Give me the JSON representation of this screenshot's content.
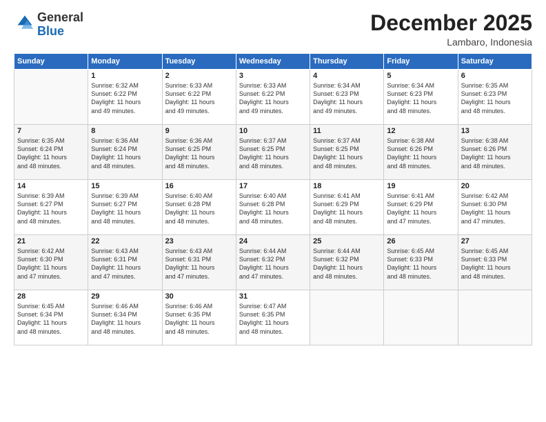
{
  "logo": {
    "general": "General",
    "blue": "Blue"
  },
  "header": {
    "month": "December 2025",
    "location": "Lambaro, Indonesia"
  },
  "days_of_week": [
    "Sunday",
    "Monday",
    "Tuesday",
    "Wednesday",
    "Thursday",
    "Friday",
    "Saturday"
  ],
  "weeks": [
    [
      {
        "day": "",
        "sunrise": "",
        "sunset": "",
        "daylight": ""
      },
      {
        "day": "1",
        "sunrise": "6:32 AM",
        "sunset": "6:22 PM",
        "daylight": "11 hours and 49 minutes."
      },
      {
        "day": "2",
        "sunrise": "6:33 AM",
        "sunset": "6:22 PM",
        "daylight": "11 hours and 49 minutes."
      },
      {
        "day": "3",
        "sunrise": "6:33 AM",
        "sunset": "6:22 PM",
        "daylight": "11 hours and 49 minutes."
      },
      {
        "day": "4",
        "sunrise": "6:34 AM",
        "sunset": "6:23 PM",
        "daylight": "11 hours and 49 minutes."
      },
      {
        "day": "5",
        "sunrise": "6:34 AM",
        "sunset": "6:23 PM",
        "daylight": "11 hours and 48 minutes."
      },
      {
        "day": "6",
        "sunrise": "6:35 AM",
        "sunset": "6:23 PM",
        "daylight": "11 hours and 48 minutes."
      }
    ],
    [
      {
        "day": "7",
        "sunrise": "6:35 AM",
        "sunset": "6:24 PM",
        "daylight": "11 hours and 48 minutes."
      },
      {
        "day": "8",
        "sunrise": "6:36 AM",
        "sunset": "6:24 PM",
        "daylight": "11 hours and 48 minutes."
      },
      {
        "day": "9",
        "sunrise": "6:36 AM",
        "sunset": "6:25 PM",
        "daylight": "11 hours and 48 minutes."
      },
      {
        "day": "10",
        "sunrise": "6:37 AM",
        "sunset": "6:25 PM",
        "daylight": "11 hours and 48 minutes."
      },
      {
        "day": "11",
        "sunrise": "6:37 AM",
        "sunset": "6:25 PM",
        "daylight": "11 hours and 48 minutes."
      },
      {
        "day": "12",
        "sunrise": "6:38 AM",
        "sunset": "6:26 PM",
        "daylight": "11 hours and 48 minutes."
      },
      {
        "day": "13",
        "sunrise": "6:38 AM",
        "sunset": "6:26 PM",
        "daylight": "11 hours and 48 minutes."
      }
    ],
    [
      {
        "day": "14",
        "sunrise": "6:39 AM",
        "sunset": "6:27 PM",
        "daylight": "11 hours and 48 minutes."
      },
      {
        "day": "15",
        "sunrise": "6:39 AM",
        "sunset": "6:27 PM",
        "daylight": "11 hours and 48 minutes."
      },
      {
        "day": "16",
        "sunrise": "6:40 AM",
        "sunset": "6:28 PM",
        "daylight": "11 hours and 48 minutes."
      },
      {
        "day": "17",
        "sunrise": "6:40 AM",
        "sunset": "6:28 PM",
        "daylight": "11 hours and 48 minutes."
      },
      {
        "day": "18",
        "sunrise": "6:41 AM",
        "sunset": "6:29 PM",
        "daylight": "11 hours and 48 minutes."
      },
      {
        "day": "19",
        "sunrise": "6:41 AM",
        "sunset": "6:29 PM",
        "daylight": "11 hours and 47 minutes."
      },
      {
        "day": "20",
        "sunrise": "6:42 AM",
        "sunset": "6:30 PM",
        "daylight": "11 hours and 47 minutes."
      }
    ],
    [
      {
        "day": "21",
        "sunrise": "6:42 AM",
        "sunset": "6:30 PM",
        "daylight": "11 hours and 47 minutes."
      },
      {
        "day": "22",
        "sunrise": "6:43 AM",
        "sunset": "6:31 PM",
        "daylight": "11 hours and 47 minutes."
      },
      {
        "day": "23",
        "sunrise": "6:43 AM",
        "sunset": "6:31 PM",
        "daylight": "11 hours and 47 minutes."
      },
      {
        "day": "24",
        "sunrise": "6:44 AM",
        "sunset": "6:32 PM",
        "daylight": "11 hours and 47 minutes."
      },
      {
        "day": "25",
        "sunrise": "6:44 AM",
        "sunset": "6:32 PM",
        "daylight": "11 hours and 48 minutes."
      },
      {
        "day": "26",
        "sunrise": "6:45 AM",
        "sunset": "6:33 PM",
        "daylight": "11 hours and 48 minutes."
      },
      {
        "day": "27",
        "sunrise": "6:45 AM",
        "sunset": "6:33 PM",
        "daylight": "11 hours and 48 minutes."
      }
    ],
    [
      {
        "day": "28",
        "sunrise": "6:45 AM",
        "sunset": "6:34 PM",
        "daylight": "11 hours and 48 minutes."
      },
      {
        "day": "29",
        "sunrise": "6:46 AM",
        "sunset": "6:34 PM",
        "daylight": "11 hours and 48 minutes."
      },
      {
        "day": "30",
        "sunrise": "6:46 AM",
        "sunset": "6:35 PM",
        "daylight": "11 hours and 48 minutes."
      },
      {
        "day": "31",
        "sunrise": "6:47 AM",
        "sunset": "6:35 PM",
        "daylight": "11 hours and 48 minutes."
      },
      {
        "day": "",
        "sunrise": "",
        "sunset": "",
        "daylight": ""
      },
      {
        "day": "",
        "sunrise": "",
        "sunset": "",
        "daylight": ""
      },
      {
        "day": "",
        "sunrise": "",
        "sunset": "",
        "daylight": ""
      }
    ]
  ]
}
